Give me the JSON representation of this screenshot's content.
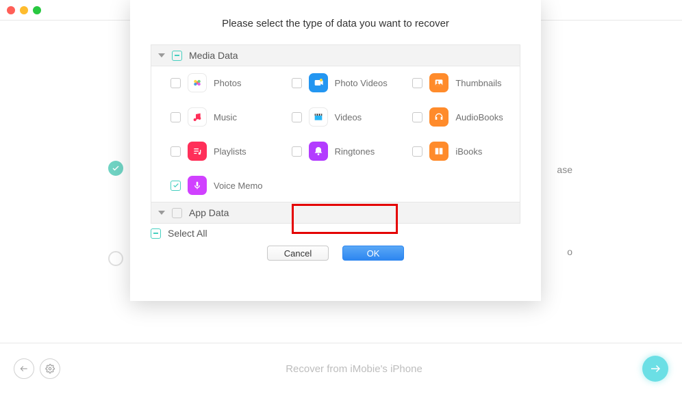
{
  "window": {
    "footer_title": "Recover from iMobie's iPhone"
  },
  "modal": {
    "title": "Please select the type of data you want to recover",
    "sections": {
      "media": {
        "label": "Media Data"
      },
      "appdata": {
        "label": "App Data"
      }
    },
    "items": {
      "photos": "Photos",
      "photo_videos": "Photo Videos",
      "thumbnails": "Thumbnails",
      "music": "Music",
      "videos": "Videos",
      "audiobooks": "AudioBooks",
      "playlists": "Playlists",
      "ringtones": "Ringtones",
      "ibooks": "iBooks",
      "voice_memo": "Voice Memo"
    },
    "select_all": "Select All",
    "cancel": "Cancel",
    "ok": "OK"
  },
  "colors": {
    "photos": "#ffffff",
    "photo_videos": "#2396f1",
    "thumbnails": "#ff8b2b",
    "music": "#ffffff",
    "videos": "#ffffff",
    "audiobooks": "#ff8b2b",
    "playlists": "#ff2f59",
    "ringtones": "#b33cff",
    "ibooks": "#ff8b2b",
    "voice_memo": "#d041ff"
  },
  "background": {
    "text1": "ase",
    "text2": "o"
  }
}
